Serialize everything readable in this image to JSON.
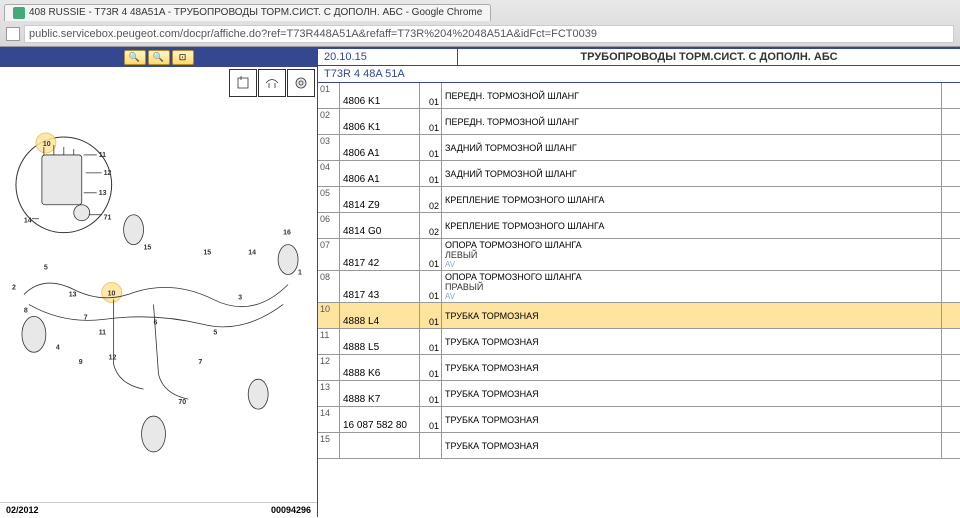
{
  "browser": {
    "tab_title": "408 RUSSIE - T73R 4 48A51A - ТРУБОПРОВОДЫ ТОРМ.СИСТ. С ДОПОЛН. АБС - Google Chrome",
    "url": "public.servicebox.peugeot.com/docpr/affiche.do?ref=T73R448A51A&refaff=T73R%204%2048A51A&idFct=FCT0039"
  },
  "header": {
    "date": "20.10.15",
    "ref": "T73R 4 48A 51A",
    "title": "ТРУБОПРОВОДЫ ТОРМ.СИСТ. С ДОПОЛН. АБС"
  },
  "diagram": {
    "footer_date": "02/2012",
    "footer_code": "00094296",
    "callouts": [
      "10",
      "11",
      "12",
      "13",
      "14",
      "71",
      "2",
      "5",
      "8",
      "13",
      "15",
      "10",
      "7",
      "11",
      "6",
      "15",
      "3",
      "14",
      "16",
      "1",
      "4",
      "9",
      "12",
      "5",
      "7",
      "70"
    ]
  },
  "parts": [
    {
      "num": "01",
      "ref": "4806 K1",
      "qty": "01",
      "desc": "ПЕРЕДН. ТОРМОЗНОЙ ШЛАНГ"
    },
    {
      "num": "02",
      "ref": "4806 K1",
      "qty": "01",
      "desc": "ПЕРЕДН. ТОРМОЗНОЙ ШЛАНГ"
    },
    {
      "num": "03",
      "ref": "4806 A1",
      "qty": "01",
      "desc": "ЗАДНИЙ ТОРМОЗНОЙ ШЛАНГ"
    },
    {
      "num": "04",
      "ref": "4806 A1",
      "qty": "01",
      "desc": "ЗАДНИЙ ТОРМОЗНОЙ ШЛАНГ"
    },
    {
      "num": "05",
      "ref": "4814 Z9",
      "qty": "02",
      "desc": "КРЕПЛЕНИЕ ТОРМОЗНОГО ШЛАНГА"
    },
    {
      "num": "06",
      "ref": "4814 G0",
      "qty": "02",
      "desc": "КРЕПЛЕНИЕ ТОРМОЗНОГО ШЛАНГА"
    },
    {
      "num": "07",
      "ref": "4817 42",
      "qty": "01",
      "desc": "ОПОРА ТОРМОЗНОГО ШЛАНГА",
      "sub": "ЛЕВЫЙ",
      "note": "AV"
    },
    {
      "num": "08",
      "ref": "4817 43",
      "qty": "01",
      "desc": "ОПОРА ТОРМОЗНОГО ШЛАНГА",
      "sub": "ПРАВЫЙ",
      "note": "AV"
    },
    {
      "num": "10",
      "ref": "4888 L4",
      "qty": "01",
      "desc": "ТРУБКА ТОРМОЗНАЯ",
      "hl": true
    },
    {
      "num": "11",
      "ref": "4888 L5",
      "qty": "01",
      "desc": "ТРУБКА ТОРМОЗНАЯ"
    },
    {
      "num": "12",
      "ref": "4888 K6",
      "qty": "01",
      "desc": "ТРУБКА ТОРМОЗНАЯ"
    },
    {
      "num": "13",
      "ref": "4888 K7",
      "qty": "01",
      "desc": "ТРУБКА ТОРМОЗНАЯ"
    },
    {
      "num": "14",
      "ref": "16 087 582 80",
      "qty": "01",
      "desc": "ТРУБКА ТОРМОЗНАЯ"
    },
    {
      "num": "15",
      "ref": "",
      "qty": "",
      "desc": "ТРУБКА ТОРМОЗНАЯ"
    }
  ]
}
